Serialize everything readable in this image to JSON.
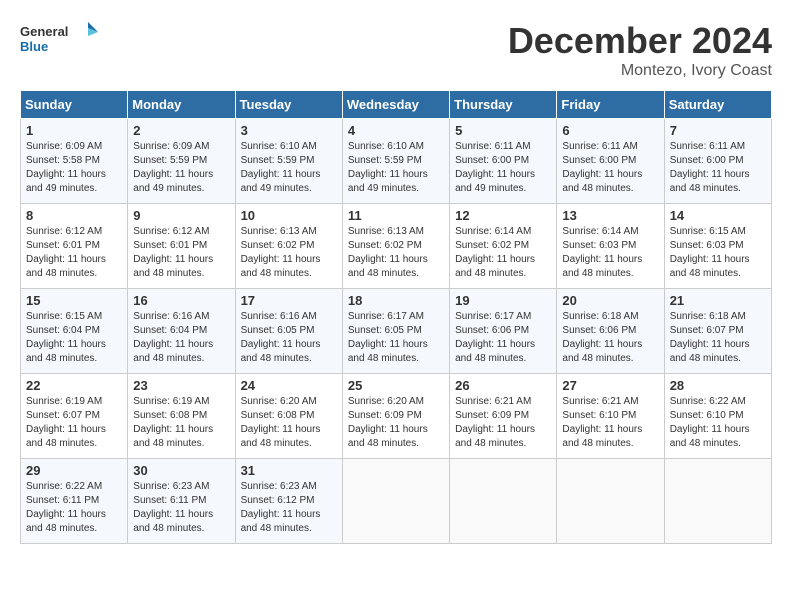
{
  "logo": {
    "general": "General",
    "blue": "Blue"
  },
  "title": "December 2024",
  "subtitle": "Montezo, Ivory Coast",
  "days_of_week": [
    "Sunday",
    "Monday",
    "Tuesday",
    "Wednesday",
    "Thursday",
    "Friday",
    "Saturday"
  ],
  "weeks": [
    [
      {
        "day": "1",
        "sunrise": "6:09 AM",
        "sunset": "5:58 PM",
        "daylight": "11 hours and 49 minutes."
      },
      {
        "day": "2",
        "sunrise": "6:09 AM",
        "sunset": "5:59 PM",
        "daylight": "11 hours and 49 minutes."
      },
      {
        "day": "3",
        "sunrise": "6:10 AM",
        "sunset": "5:59 PM",
        "daylight": "11 hours and 49 minutes."
      },
      {
        "day": "4",
        "sunrise": "6:10 AM",
        "sunset": "5:59 PM",
        "daylight": "11 hours and 49 minutes."
      },
      {
        "day": "5",
        "sunrise": "6:11 AM",
        "sunset": "6:00 PM",
        "daylight": "11 hours and 49 minutes."
      },
      {
        "day": "6",
        "sunrise": "6:11 AM",
        "sunset": "6:00 PM",
        "daylight": "11 hours and 48 minutes."
      },
      {
        "day": "7",
        "sunrise": "6:11 AM",
        "sunset": "6:00 PM",
        "daylight": "11 hours and 48 minutes."
      }
    ],
    [
      {
        "day": "8",
        "sunrise": "6:12 AM",
        "sunset": "6:01 PM",
        "daylight": "11 hours and 48 minutes."
      },
      {
        "day": "9",
        "sunrise": "6:12 AM",
        "sunset": "6:01 PM",
        "daylight": "11 hours and 48 minutes."
      },
      {
        "day": "10",
        "sunrise": "6:13 AM",
        "sunset": "6:02 PM",
        "daylight": "11 hours and 48 minutes."
      },
      {
        "day": "11",
        "sunrise": "6:13 AM",
        "sunset": "6:02 PM",
        "daylight": "11 hours and 48 minutes."
      },
      {
        "day": "12",
        "sunrise": "6:14 AM",
        "sunset": "6:02 PM",
        "daylight": "11 hours and 48 minutes."
      },
      {
        "day": "13",
        "sunrise": "6:14 AM",
        "sunset": "6:03 PM",
        "daylight": "11 hours and 48 minutes."
      },
      {
        "day": "14",
        "sunrise": "6:15 AM",
        "sunset": "6:03 PM",
        "daylight": "11 hours and 48 minutes."
      }
    ],
    [
      {
        "day": "15",
        "sunrise": "6:15 AM",
        "sunset": "6:04 PM",
        "daylight": "11 hours and 48 minutes."
      },
      {
        "day": "16",
        "sunrise": "6:16 AM",
        "sunset": "6:04 PM",
        "daylight": "11 hours and 48 minutes."
      },
      {
        "day": "17",
        "sunrise": "6:16 AM",
        "sunset": "6:05 PM",
        "daylight": "11 hours and 48 minutes."
      },
      {
        "day": "18",
        "sunrise": "6:17 AM",
        "sunset": "6:05 PM",
        "daylight": "11 hours and 48 minutes."
      },
      {
        "day": "19",
        "sunrise": "6:17 AM",
        "sunset": "6:06 PM",
        "daylight": "11 hours and 48 minutes."
      },
      {
        "day": "20",
        "sunrise": "6:18 AM",
        "sunset": "6:06 PM",
        "daylight": "11 hours and 48 minutes."
      },
      {
        "day": "21",
        "sunrise": "6:18 AM",
        "sunset": "6:07 PM",
        "daylight": "11 hours and 48 minutes."
      }
    ],
    [
      {
        "day": "22",
        "sunrise": "6:19 AM",
        "sunset": "6:07 PM",
        "daylight": "11 hours and 48 minutes."
      },
      {
        "day": "23",
        "sunrise": "6:19 AM",
        "sunset": "6:08 PM",
        "daylight": "11 hours and 48 minutes."
      },
      {
        "day": "24",
        "sunrise": "6:20 AM",
        "sunset": "6:08 PM",
        "daylight": "11 hours and 48 minutes."
      },
      {
        "day": "25",
        "sunrise": "6:20 AM",
        "sunset": "6:09 PM",
        "daylight": "11 hours and 48 minutes."
      },
      {
        "day": "26",
        "sunrise": "6:21 AM",
        "sunset": "6:09 PM",
        "daylight": "11 hours and 48 minutes."
      },
      {
        "day": "27",
        "sunrise": "6:21 AM",
        "sunset": "6:10 PM",
        "daylight": "11 hours and 48 minutes."
      },
      {
        "day": "28",
        "sunrise": "6:22 AM",
        "sunset": "6:10 PM",
        "daylight": "11 hours and 48 minutes."
      }
    ],
    [
      {
        "day": "29",
        "sunrise": "6:22 AM",
        "sunset": "6:11 PM",
        "daylight": "11 hours and 48 minutes."
      },
      {
        "day": "30",
        "sunrise": "6:23 AM",
        "sunset": "6:11 PM",
        "daylight": "11 hours and 48 minutes."
      },
      {
        "day": "31",
        "sunrise": "6:23 AM",
        "sunset": "6:12 PM",
        "daylight": "11 hours and 48 minutes."
      },
      null,
      null,
      null,
      null
    ]
  ]
}
